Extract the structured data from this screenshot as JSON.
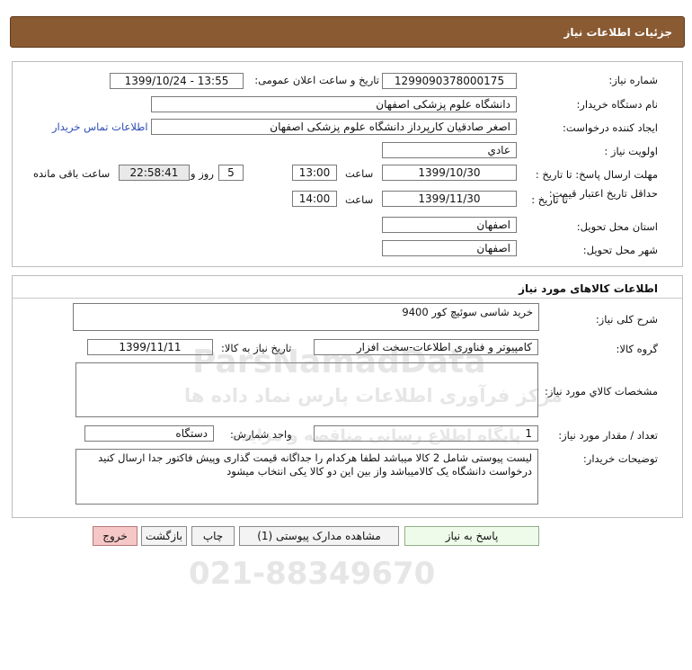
{
  "header": {
    "title": "جزئیات اطلاعات نیاز"
  },
  "need_info": {
    "need_number_label": "شماره نیاز:",
    "need_number": "1299090378000175",
    "announce_label": "تاریخ و ساعت اعلان عمومی:",
    "announce_value": "1399/10/24 - 13:55",
    "buyer_org_label": "نام دستگاه خریدار:",
    "buyer_org": "دانشگاه علوم پزشکی اصفهان",
    "requester_label": "ایجاد کننده درخواست:",
    "requester": "اصغر صادقیان کارپرداز دانشگاه علوم پزشکی اصفهان",
    "contact_link": "اطلاعات تماس خریدار",
    "priority_label": "اولویت نیاز :",
    "priority": "عادي",
    "send_deadline_label": "مهلت ارسال پاسخ: تا تاریخ :",
    "send_deadline_date": "1399/10/30",
    "time_label": "ساعت",
    "send_deadline_time": "13:00",
    "days_value": "5",
    "days_label": "روز و",
    "remaining_time": "22:58:41",
    "remaining_label": "ساعت باقی مانده",
    "price_validity_label": "حداقل تاریخ اعتبار قیمت:",
    "price_validity_sub": "تا تاریخ :",
    "price_validity_date": "1399/11/30",
    "time_label2": "ساعت",
    "price_validity_time": "14:00",
    "province_label": "استان محل تحویل:",
    "province": "اصفهان",
    "city_label": "شهر محل تحویل:",
    "city": "اصفهان"
  },
  "goods": {
    "section_title": "اطلاعات کالاهای مورد نیاز",
    "summary_label": "شرح کلی نیاز:",
    "summary": "خرید شاسی سوئیچ کور 9400",
    "group_label": "گروه کالا:",
    "group": "کامپیوتر و فناوری اطلاعات-سخت افزار",
    "need_date_label": "تاریخ نیاز به کالا:",
    "need_date": "1399/11/11",
    "specs_label": "مشخصات کالاي مورد نياز:",
    "specs": "",
    "qty_label": "تعداد / مقدار مورد نیاز:",
    "qty": "1",
    "unit_label": "واحد شمارش:",
    "unit": "دستگاه",
    "notes_label": "توضیحات خریدار:",
    "notes_line1": "لیست پیوستی شامل 2 کالا میباشد لطفا هرکدام را جداگانه قیمت گذاری وپیش فاکتور جدا ارسال کنید",
    "notes_line2": "درخواست دانشگاه یک کالامیباشد واز بین این دو کالا یکی انتخاب میشود"
  },
  "buttons": {
    "reply": "پاسخ به نیاز",
    "attachments": "مشاهده مدارک پیوستی (1)",
    "print": "چاپ",
    "back": "بازگشت",
    "exit": "خروج"
  },
  "watermark": {
    "brand": "ParsNamadData",
    "tagline": "مرکز فرآوری اطلاعات پارس نماد داده ها",
    "subline": "پایگاه اطلاع رسانی مناقصه و مزایده",
    "phone": "021-88349670"
  },
  "colors": {
    "header_bg": "#8a5a32",
    "link": "#2a4db3",
    "exit_bg": "#f6c7c7"
  }
}
